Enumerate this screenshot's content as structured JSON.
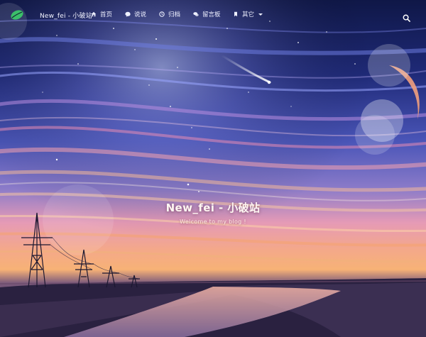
{
  "header": {
    "site_title": "New_fei - 小破站",
    "nav": [
      {
        "label": "首页",
        "icon": "home-icon"
      },
      {
        "label": "说说",
        "icon": "comment-dots-icon"
      },
      {
        "label": "归档",
        "icon": "clock-icon"
      },
      {
        "label": "留言板",
        "icon": "chat-bubbles-icon"
      },
      {
        "label": "其它",
        "icon": "bookmark-icon"
      }
    ],
    "search_icon": "search-icon",
    "logo_icon": "leaf-logo-icon"
  },
  "hero": {
    "title": "New_fei - 小破站",
    "subtitle": "Welcome to my blog !"
  },
  "colors": {
    "sky_top": "#111a4a",
    "sky_mid": "#3a3f9a",
    "horizon_pink": "#f08c92",
    "horizon_orange": "#f6a36a",
    "water": "#2d2340",
    "logo_green": "#3bbf6a"
  }
}
